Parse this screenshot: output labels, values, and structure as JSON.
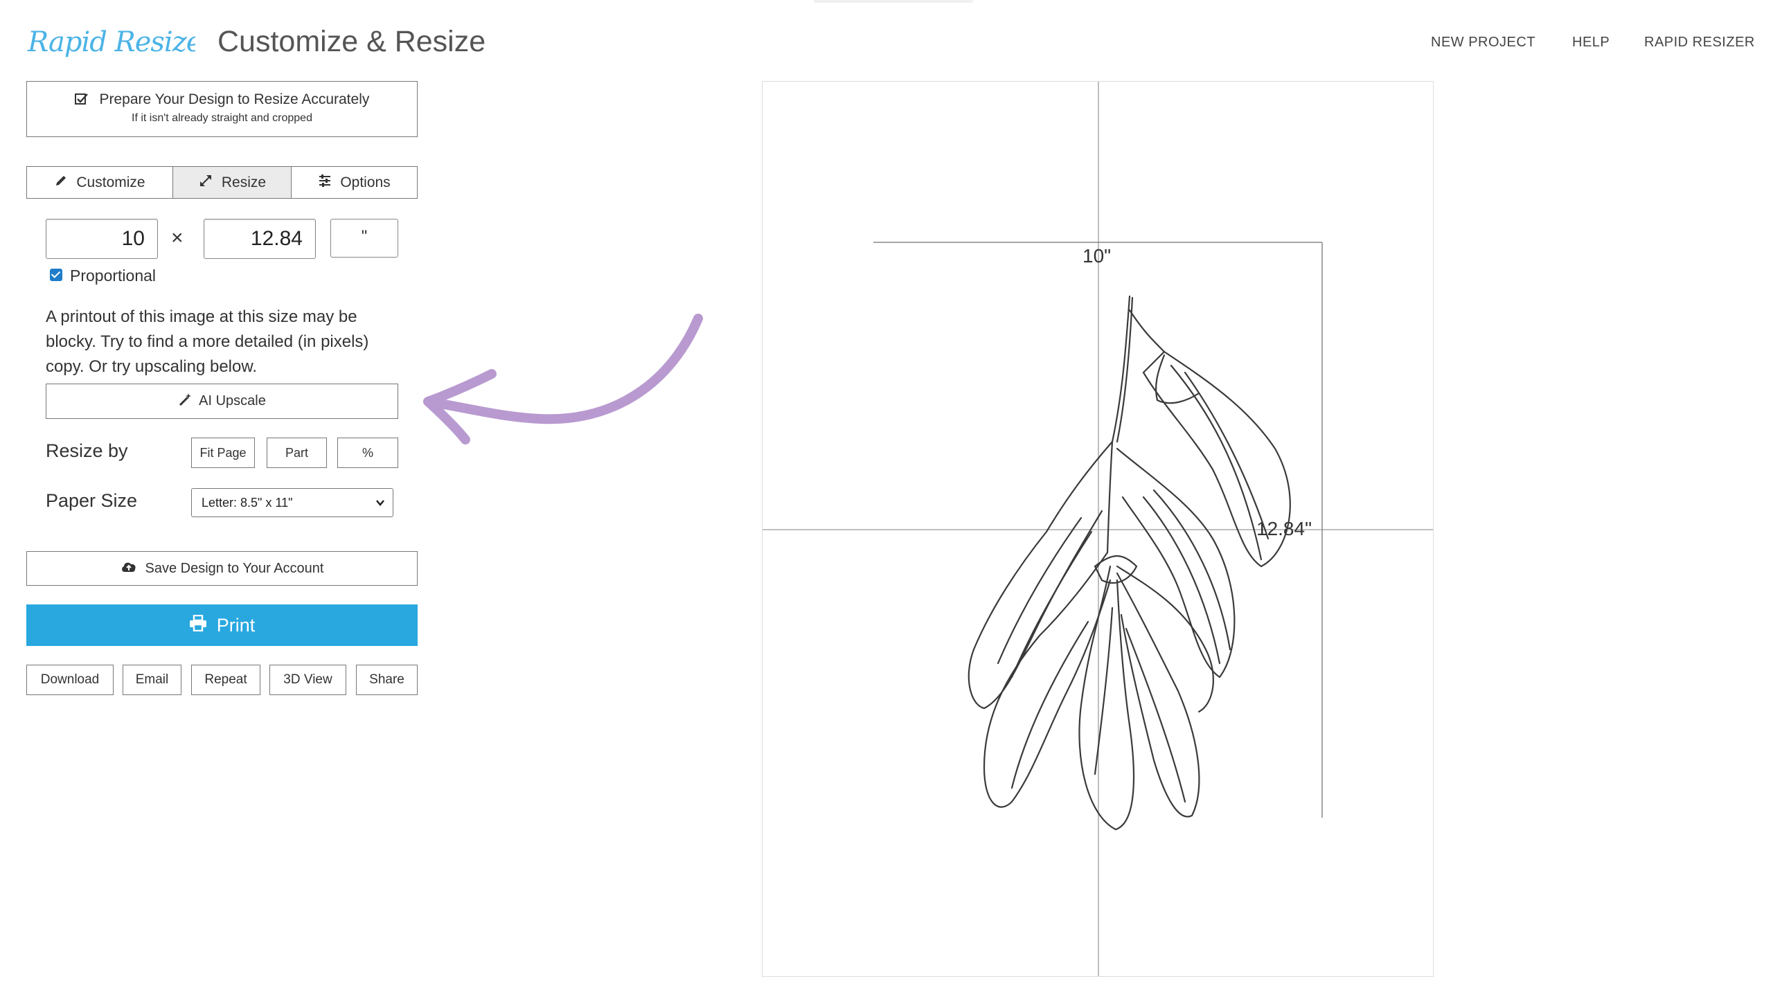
{
  "header": {
    "logo_text": "Rapid Resizer",
    "title": "Customize & Resize",
    "nav": [
      "NEW PROJECT",
      "HELP",
      "RAPID RESIZER"
    ]
  },
  "prepare": {
    "title": "Prepare Your Design to Resize Accurately",
    "subtitle": "If it isn't already straight and cropped"
  },
  "tabs": [
    {
      "label": "Customize",
      "icon": "pencil-icon",
      "active": false
    },
    {
      "label": "Resize",
      "icon": "expand-arrows-icon",
      "active": true
    },
    {
      "label": "Options",
      "icon": "sliders-icon",
      "active": false
    }
  ],
  "size": {
    "width": "10",
    "height": "12.84",
    "times": "×",
    "unit": "\"",
    "proportional_label": "Proportional",
    "proportional_checked": true
  },
  "warning": "A printout of this image at this size may be blocky. Try to find a more detailed (in pixels) copy. Or try upscaling below.",
  "upscale_label": "AI Upscale",
  "resize_by": {
    "label": "Resize by",
    "options": [
      "Fit Page",
      "Part",
      "%"
    ]
  },
  "paper": {
    "label": "Paper Size",
    "selected": "Letter: 8.5\" x 11\""
  },
  "save_label": "Save Design to Your Account",
  "print_label": "Print",
  "actions": [
    "Download",
    "Email",
    "Repeat",
    "3D View",
    "Share"
  ],
  "preview": {
    "width_label": "10\"",
    "height_label": "12.84\""
  },
  "colors": {
    "accent": "#29a8e0",
    "logo": "#4bb3e6",
    "arrow": "#b89ad0"
  }
}
